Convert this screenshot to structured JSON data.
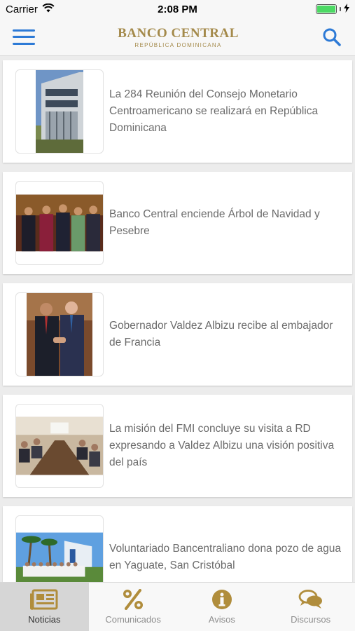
{
  "status_bar": {
    "carrier": "Carrier",
    "time": "2:08 PM"
  },
  "header": {
    "logo_title": "BANCO CENTRAL",
    "logo_subtitle": "REPÚBLICA DOMINICANA"
  },
  "news": [
    {
      "title": "La 284 Reunión del Consejo Monetario Centroamericano se realizará en República Dominicana",
      "image": "building-photo"
    },
    {
      "title": "Banco Central enciende Árbol de Navidad y Pesebre",
      "image": "group-photo"
    },
    {
      "title": "Gobernador Valdez Albizu recibe al embajador de Francia",
      "image": "handshake-photo"
    },
    {
      "title": "La misión del FMI concluye su visita a RD expresando a Valdez Albizu una visión positiva del país",
      "image": "meeting-photo"
    },
    {
      "title": "Voluntariado Bancentraliano dona pozo de agua en Yaguate, San Cristóbal",
      "image": "volunteers-photo"
    }
  ],
  "tabs": [
    {
      "label": "Noticias",
      "icon": "newspaper-icon",
      "active": true
    },
    {
      "label": "Comunicados",
      "icon": "percent-icon",
      "active": false
    },
    {
      "label": "Avisos",
      "icon": "info-icon",
      "active": false
    },
    {
      "label": "Discursos",
      "icon": "speech-bubbles-icon",
      "active": false
    }
  ],
  "colors": {
    "accent": "#2d7ad6",
    "gold": "#a48a4b",
    "battery": "#4cd964"
  }
}
